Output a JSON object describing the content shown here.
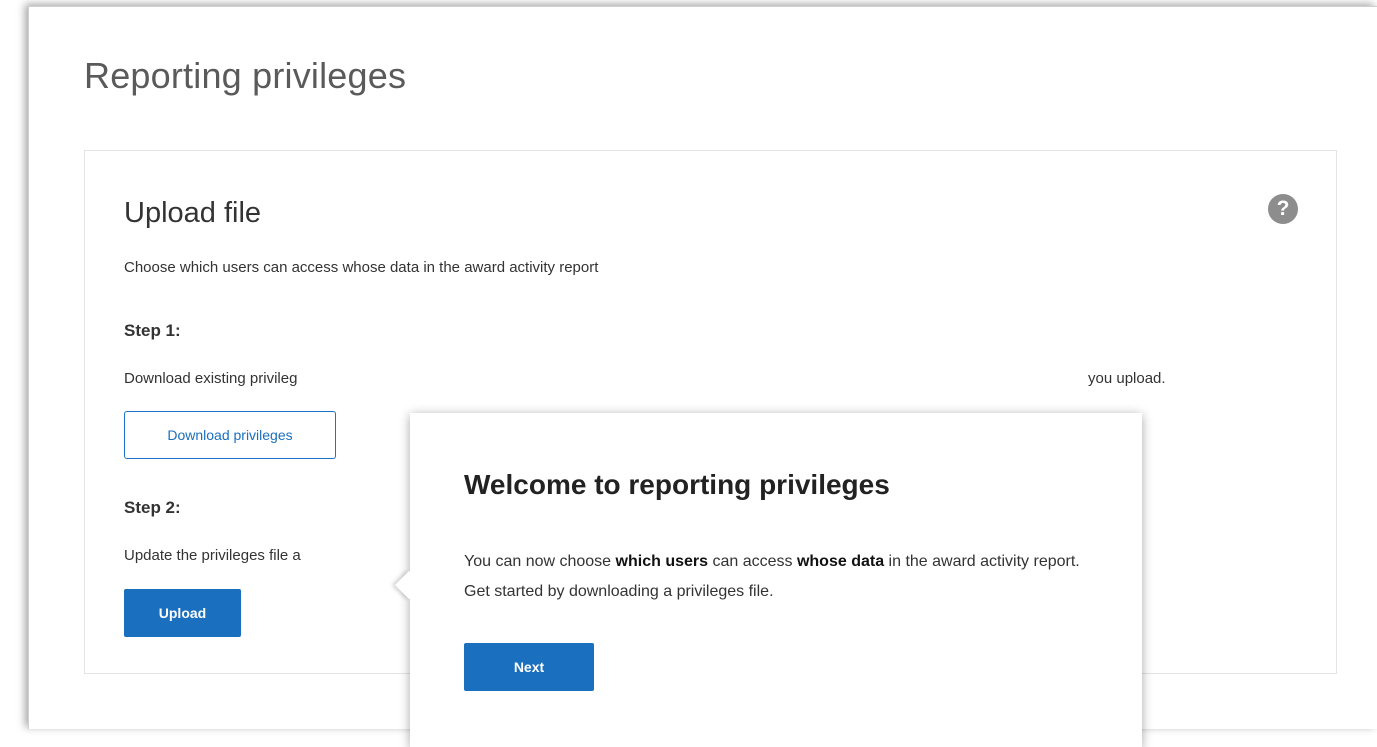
{
  "page": {
    "title": "Reporting privileges"
  },
  "card": {
    "title": "Upload file",
    "description": "Choose which users can access whose data in the award activity report",
    "help_icon_glyph": "?",
    "step1": {
      "heading": "Step 1:",
      "text": "Download existing privileg",
      "text_tail": "you upload.",
      "button_label": "Download privileges"
    },
    "step2": {
      "heading": "Step 2:",
      "text": "Update the privileges file a",
      "button_label": "Upload"
    }
  },
  "popover": {
    "title": "Welcome to reporting privileges",
    "body_part1": "You can now choose ",
    "body_bold1": "which users",
    "body_part2": " can access ",
    "body_bold2": "whose data",
    "body_part3": " in the award activity report. Get started by downloading a privileges file.",
    "next_label": "Next"
  },
  "colors": {
    "primary": "#1a6fbe",
    "help_icon": "#8d8d8d"
  }
}
